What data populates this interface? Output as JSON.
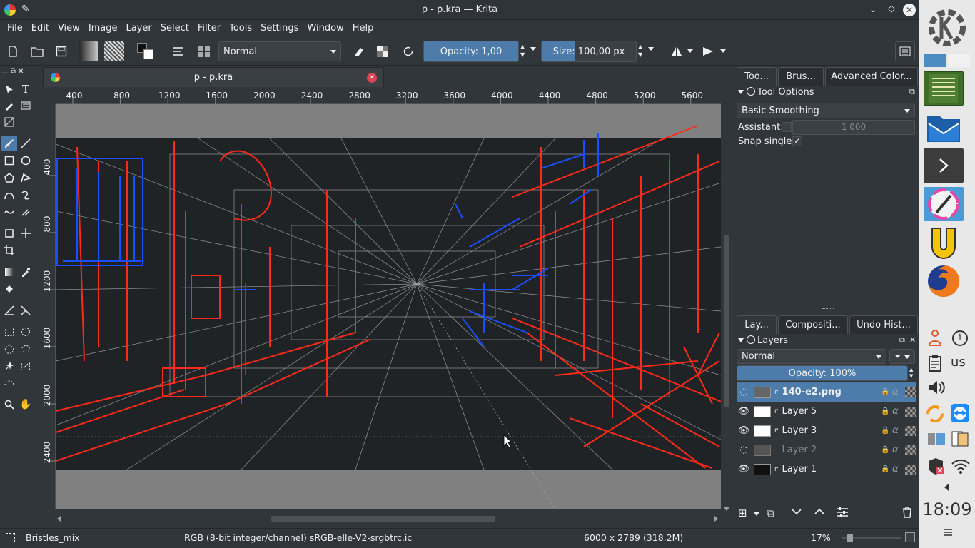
{
  "window": {
    "title": "p - p.kra  — Krita"
  },
  "menu": [
    "File",
    "Edit",
    "View",
    "Image",
    "Layer",
    "Select",
    "Filter",
    "Tools",
    "Settings",
    "Window",
    "Help"
  ],
  "toolbar": {
    "blend_mode": "Normal",
    "opacity_label": "Opacity: 1,00",
    "opacity_value": 1.0,
    "size_label": "Size:  100,00 px",
    "size_fraction": 0.35
  },
  "document": {
    "tab_title": "p - p.kra",
    "hruler": [
      "400",
      "800",
      "1200",
      "1600",
      "2000",
      "2400",
      "2800",
      "3200",
      "3600",
      "4000",
      "4400",
      "4800",
      "5200",
      "5600"
    ],
    "vruler": [
      "400",
      "800",
      "1200",
      "1600",
      "2000",
      "2400"
    ]
  },
  "dock_top": {
    "tabs": [
      "Too...",
      "Brus...",
      "Advanced Color..."
    ],
    "panel_title": "Tool Options",
    "smoothing": "Basic Smoothing",
    "assistant_label": "Assistant:",
    "assistant_value": "1 000",
    "snap_label": "Snap single:",
    "snap_check": "✓"
  },
  "dock_bottom": {
    "tabs": [
      "Lay...",
      "Compositi...",
      "Undo Hist..."
    ],
    "panel_title": "Layers",
    "blend_mode": "Normal",
    "opacity_label": "Opacity:  100%",
    "layers": [
      {
        "name": "140-e2.png",
        "visible": false,
        "selected": true
      },
      {
        "name": "Layer 5",
        "visible": true,
        "selected": false
      },
      {
        "name": "Layer 3",
        "visible": true,
        "selected": false
      },
      {
        "name": "Layer 2",
        "visible": false,
        "selected": false
      },
      {
        "name": "Layer 1",
        "visible": true,
        "selected": false
      }
    ]
  },
  "status": {
    "brush": "Bristles_mix",
    "colorspace": "RGB (8-bit integer/channel)  sRGB-elle-V2-srgbtrc.ic",
    "dimensions": "6000 x 2789 (318.2M)",
    "zoom": "17%"
  },
  "panel": {
    "keyboard": "us",
    "clock": "18:09"
  },
  "colors": {
    "accent": "#4d7cab",
    "bg": "#31363b",
    "red_strokes": "#ff2a1a",
    "blue_strokes": "#1a4fff"
  }
}
